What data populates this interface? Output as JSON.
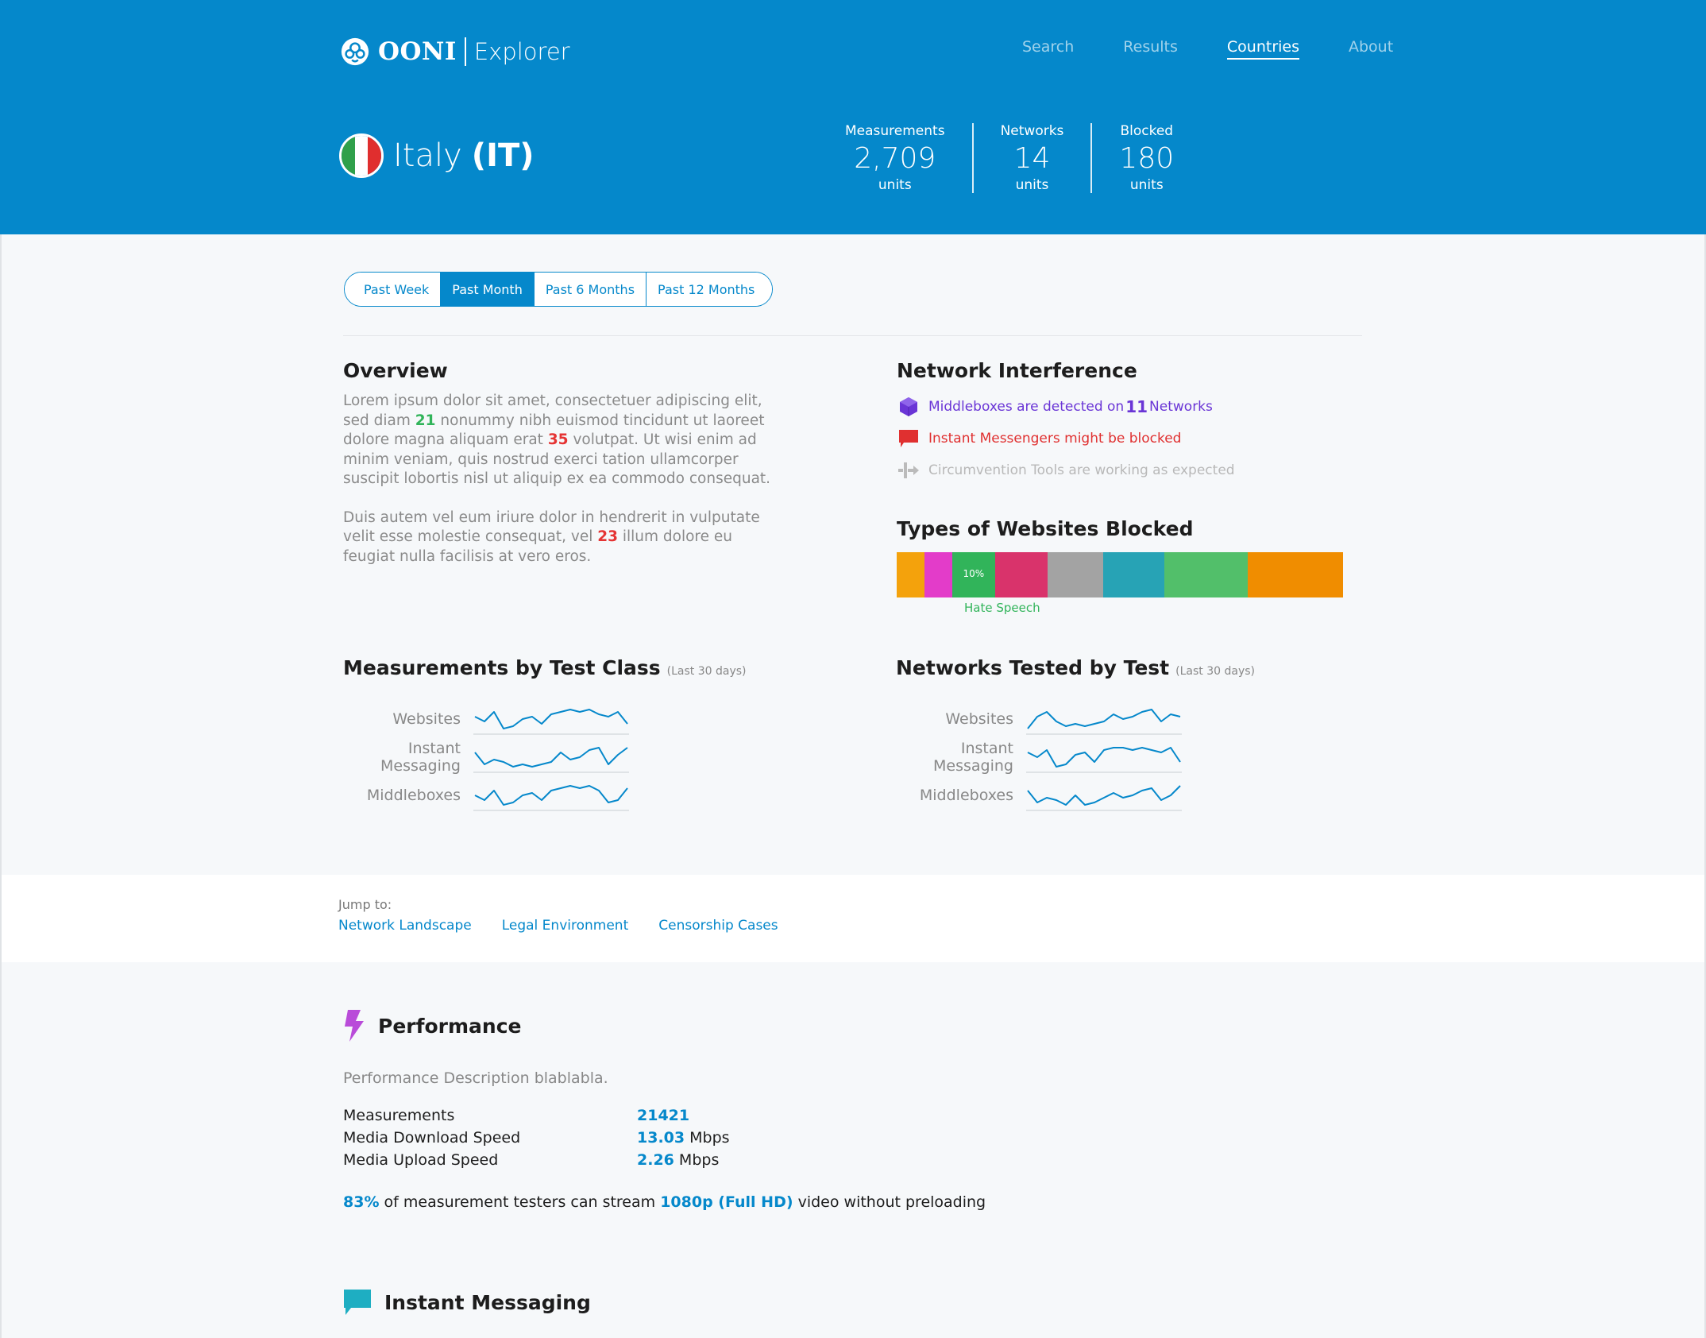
{
  "brand": {
    "name": "OONI",
    "product": "Explorer",
    "accent": "#0588cb"
  },
  "nav": {
    "items": [
      {
        "label": "Search"
      },
      {
        "label": "Results"
      },
      {
        "label": "Countries",
        "active": true
      },
      {
        "label": "About"
      }
    ]
  },
  "country": {
    "name": "Italy",
    "code": "(IT)",
    "flag_colors": [
      "#2fa04a",
      "#ffffff",
      "#e02e2e"
    ]
  },
  "stats": [
    {
      "label": "Measurements",
      "value": "2,709",
      "unit": "units"
    },
    {
      "label": "Networks",
      "value": "14",
      "unit": "units"
    },
    {
      "label": "Blocked",
      "value": "180",
      "unit": "units"
    }
  ],
  "period": {
    "options": [
      "Past Week",
      "Past Month",
      "Past 6 Months",
      "Past 12 Months"
    ],
    "selected": "Past Month"
  },
  "overview": {
    "title": "Overview",
    "p1_a": "Lorem ipsum dolor sit amet, consectetuer adipiscing elit, sed diam ",
    "p1_n1": "21",
    "p1_b": " nonummy nibh euismod tincidunt ut laoreet dolore magna aliquam erat ",
    "p1_n2": "35",
    "p1_c": " volutpat. Ut wisi enim ad minim veniam, quis nostrud exerci tation ullamcorper suscipit lobortis nisl ut aliquip ex ea commodo consequat.",
    "p2_a": "Duis autem vel eum iriure dolor in hendrerit in vulputate velit esse molestie consequat, vel ",
    "p2_n1": "23",
    "p2_b": " illum dolore eu feugiat nulla facilisis at vero eros."
  },
  "interference": {
    "title": "Network Interference",
    "middleboxes_a": "Middleboxes are detected on ",
    "middleboxes_n": "11",
    "middleboxes_b": " Networks",
    "im": "Instant Messengers might be blocked",
    "circumvention": "Circumvention Tools are working as expected",
    "colors": {
      "middleboxes": "#6a35d6",
      "im": "#e03030",
      "circumvention": "#b8b8b8"
    }
  },
  "websites_blocked": {
    "title": "Types of Websites Blocked",
    "segments": [
      {
        "share": 4.5,
        "color": "#f4a20c"
      },
      {
        "share": 4.5,
        "color": "#e33cc9"
      },
      {
        "share": 7,
        "color": "#31b45a",
        "label": "10%"
      },
      {
        "share": 8.5,
        "color": "#d9336b"
      },
      {
        "share": 9,
        "color": "#a3a3a3"
      },
      {
        "share": 10,
        "color": "#27a3b5"
      },
      {
        "share": 13.5,
        "color": "#52bf6a"
      },
      {
        "share": 15.5,
        "color": "#f08d00"
      }
    ],
    "highlight_label": "Hate Speech"
  },
  "measurements_by_test": {
    "title": "Measurements by Test Class",
    "subtitle": "(Last 30 days)",
    "rows": [
      {
        "label": "Websites",
        "series": [
          6,
          4,
          8,
          1,
          2,
          5,
          6,
          3,
          7,
          8,
          9,
          8,
          9,
          7,
          6,
          8,
          3
        ]
      },
      {
        "label": "Instant Messaging",
        "series": [
          7,
          2,
          4,
          3,
          1,
          2,
          1,
          2,
          3,
          7,
          4,
          5,
          8,
          9,
          2,
          6,
          9
        ]
      },
      {
        "label": "Middleboxes",
        "series": [
          5,
          3,
          7,
          1,
          2,
          5,
          6,
          3,
          7,
          8,
          9,
          8,
          9,
          7,
          2,
          3,
          8
        ]
      }
    ],
    "line_color": "#0588cb"
  },
  "networks_by_test": {
    "title": "Networks Tested by Test",
    "subtitle": "(Last 30 days)",
    "rows": [
      {
        "label": "Websites",
        "series": [
          1,
          6,
          8,
          4,
          2,
          3,
          2,
          3,
          4,
          7,
          5,
          6,
          8,
          9,
          4,
          7,
          6
        ]
      },
      {
        "label": "Instant Messaging",
        "series": [
          7,
          5,
          8,
          1,
          2,
          6,
          7,
          3,
          8,
          9,
          9,
          8,
          9,
          8,
          7,
          9,
          3
        ]
      },
      {
        "label": "Middleboxes",
        "series": [
          7,
          2,
          4,
          3,
          1,
          5,
          1,
          2,
          4,
          6,
          4,
          5,
          7,
          8,
          3,
          5,
          9
        ]
      }
    ],
    "line_color": "#0588cb"
  },
  "jump": {
    "label": "Jump to:",
    "links": [
      "Network Landscape",
      "Legal Environment",
      "Censorship Cases"
    ]
  },
  "performance": {
    "title": "Performance",
    "description": "Performance Description blablabla.",
    "rows": [
      {
        "key": "Measurements",
        "value": "21421",
        "unit": ""
      },
      {
        "key": "Media Download Speed",
        "value": "13.03",
        "unit": " Mbps"
      },
      {
        "key": "Media Upload Speed",
        "value": "2.26",
        "unit": " Mbps"
      }
    ],
    "note_pct": "83%",
    "note_a": " of measurement testers can stream ",
    "note_res": "1080p (Full HD)",
    "note_b": " video without preloading",
    "icon_color": "#b94cd9"
  },
  "instant_messaging": {
    "title": "Instant Messaging",
    "icon_color": "#1eaec2"
  }
}
